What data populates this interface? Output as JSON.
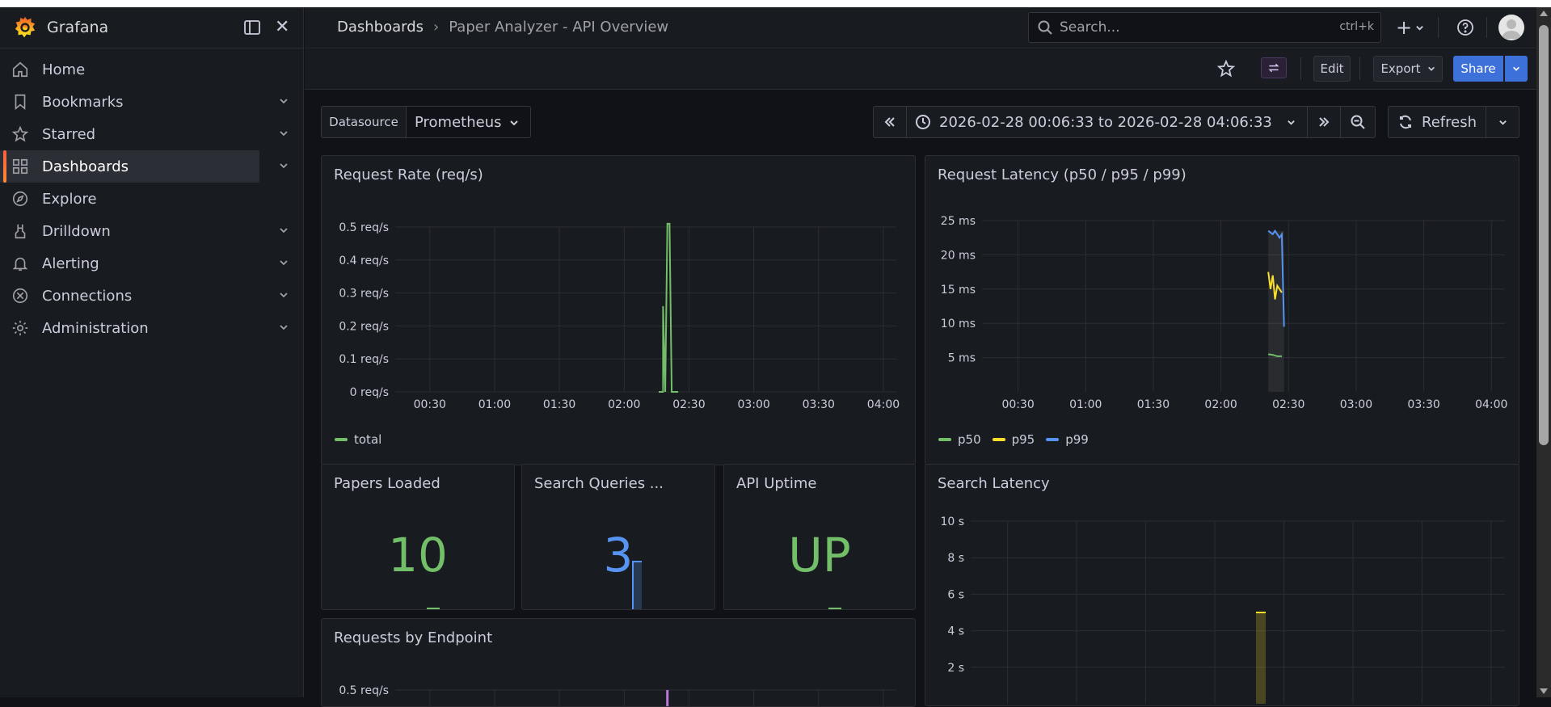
{
  "app": {
    "name": "Grafana"
  },
  "sidebar": {
    "items": [
      {
        "label": "Home",
        "icon": "home-icon"
      },
      {
        "label": "Bookmarks",
        "icon": "bookmark-icon"
      },
      {
        "label": "Starred",
        "icon": "star-icon"
      },
      {
        "label": "Dashboards",
        "icon": "dashboards-icon",
        "active": true
      },
      {
        "label": "Explore",
        "icon": "compass-icon"
      },
      {
        "label": "Drilldown",
        "icon": "drilldown-icon"
      },
      {
        "label": "Alerting",
        "icon": "bell-icon"
      },
      {
        "label": "Connections",
        "icon": "connections-icon"
      },
      {
        "label": "Administration",
        "icon": "gear-icon"
      }
    ]
  },
  "header": {
    "breadcrumb_root": "Dashboards",
    "breadcrumb_separator": "›",
    "breadcrumb_current": "Paper Analyzer - API Overview",
    "search_placeholder": "Search...",
    "search_shortcut": "ctrl+k",
    "add_label": "+"
  },
  "toolbar": {
    "edit_label": "Edit",
    "export_label": "Export",
    "share_label": "Share"
  },
  "controls": {
    "datasource_label": "Datasource",
    "datasource_value": "Prometheus",
    "time_range": "2026-02-28 00:06:33 to 2026-02-28 04:06:33",
    "refresh_label": "Refresh"
  },
  "colors": {
    "green": "#73bf69",
    "yellow": "#fade2a",
    "blue": "#5794f2",
    "purple": "#b877d9",
    "accent": "#3d71d9"
  },
  "panels": {
    "request_rate": {
      "title": "Request Rate (req/s)"
    },
    "request_latency": {
      "title": "Request Latency (p50 / p95 / p99)"
    },
    "papers_loaded": {
      "title": "Papers Loaded",
      "value": "10"
    },
    "search_queries": {
      "title": "Search Queries ...",
      "value": "3"
    },
    "api_uptime": {
      "title": "API Uptime",
      "value": "UP"
    },
    "search_latency": {
      "title": "Search Latency"
    },
    "requests_by_endpoint": {
      "title": "Requests by Endpoint"
    }
  },
  "chart_data": [
    {
      "id": "request_rate",
      "type": "line",
      "title": "Request Rate (req/s)",
      "x_ticks": [
        "00:30",
        "01:00",
        "01:30",
        "02:00",
        "02:30",
        "03:00",
        "03:30",
        "04:00"
      ],
      "y_ticks": [
        "0 req/s",
        "0.1 req/s",
        "0.2 req/s",
        "0.3 req/s",
        "0.4 req/s",
        "0.5 req/s"
      ],
      "ylim": [
        0,
        0.5
      ],
      "series": [
        {
          "name": "total",
          "color": "#73bf69",
          "x": [
            "02:16",
            "02:18",
            "02:18",
            "02:19",
            "02:19",
            "02:20",
            "02:21",
            "02:22",
            "02:22",
            "02:23",
            "02:25"
          ],
          "values": [
            0,
            0,
            0.26,
            0,
            0,
            0.51,
            0.51,
            0,
            0,
            0,
            0
          ]
        }
      ],
      "legend": "bottom-left"
    },
    {
      "id": "request_latency",
      "type": "line",
      "title": "Request Latency (p50 / p95 / p99)",
      "x_ticks": [
        "00:30",
        "01:00",
        "01:30",
        "02:00",
        "02:30",
        "03:00",
        "03:30",
        "04:00"
      ],
      "y_ticks": [
        "5 ms",
        "10 ms",
        "15 ms",
        "20 ms",
        "25 ms"
      ],
      "ylim": [
        0,
        25
      ],
      "series": [
        {
          "name": "p50",
          "color": "#73bf69",
          "x": [
            "02:21",
            "02:23",
            "02:25",
            "02:27"
          ],
          "values": [
            5.5,
            5.4,
            5.2,
            5.2
          ]
        },
        {
          "name": "p95",
          "color": "#fade2a",
          "x": [
            "02:21",
            "02:22",
            "02:23",
            "02:24",
            "02:25",
            "02:27"
          ],
          "values": [
            17.5,
            15,
            17,
            13.5,
            15.5,
            14.5
          ]
        },
        {
          "name": "p99",
          "color": "#5794f2",
          "x": [
            "02:21",
            "02:23",
            "02:24",
            "02:26",
            "02:27",
            "02:28"
          ],
          "values": [
            23.5,
            23,
            23.5,
            22.5,
            23,
            9.5
          ]
        }
      ],
      "legend": "bottom-left"
    },
    {
      "id": "search_latency",
      "type": "bar",
      "title": "Search Latency",
      "x_ticks": [],
      "y_ticks": [
        "2 s",
        "4 s",
        "6 s",
        "8 s",
        "10 s"
      ],
      "ylim": [
        0,
        10
      ],
      "series": [
        {
          "color": "#fade2a",
          "x": [
            "02:20"
          ],
          "values": [
            5
          ]
        }
      ]
    },
    {
      "id": "requests_by_endpoint",
      "type": "line",
      "title": "Requests by Endpoint",
      "y_ticks": [
        "0.5 req/s"
      ],
      "series": [
        {
          "color": "#b877d9",
          "x": [
            "02:20"
          ],
          "values": [
            0.5
          ]
        }
      ]
    }
  ]
}
